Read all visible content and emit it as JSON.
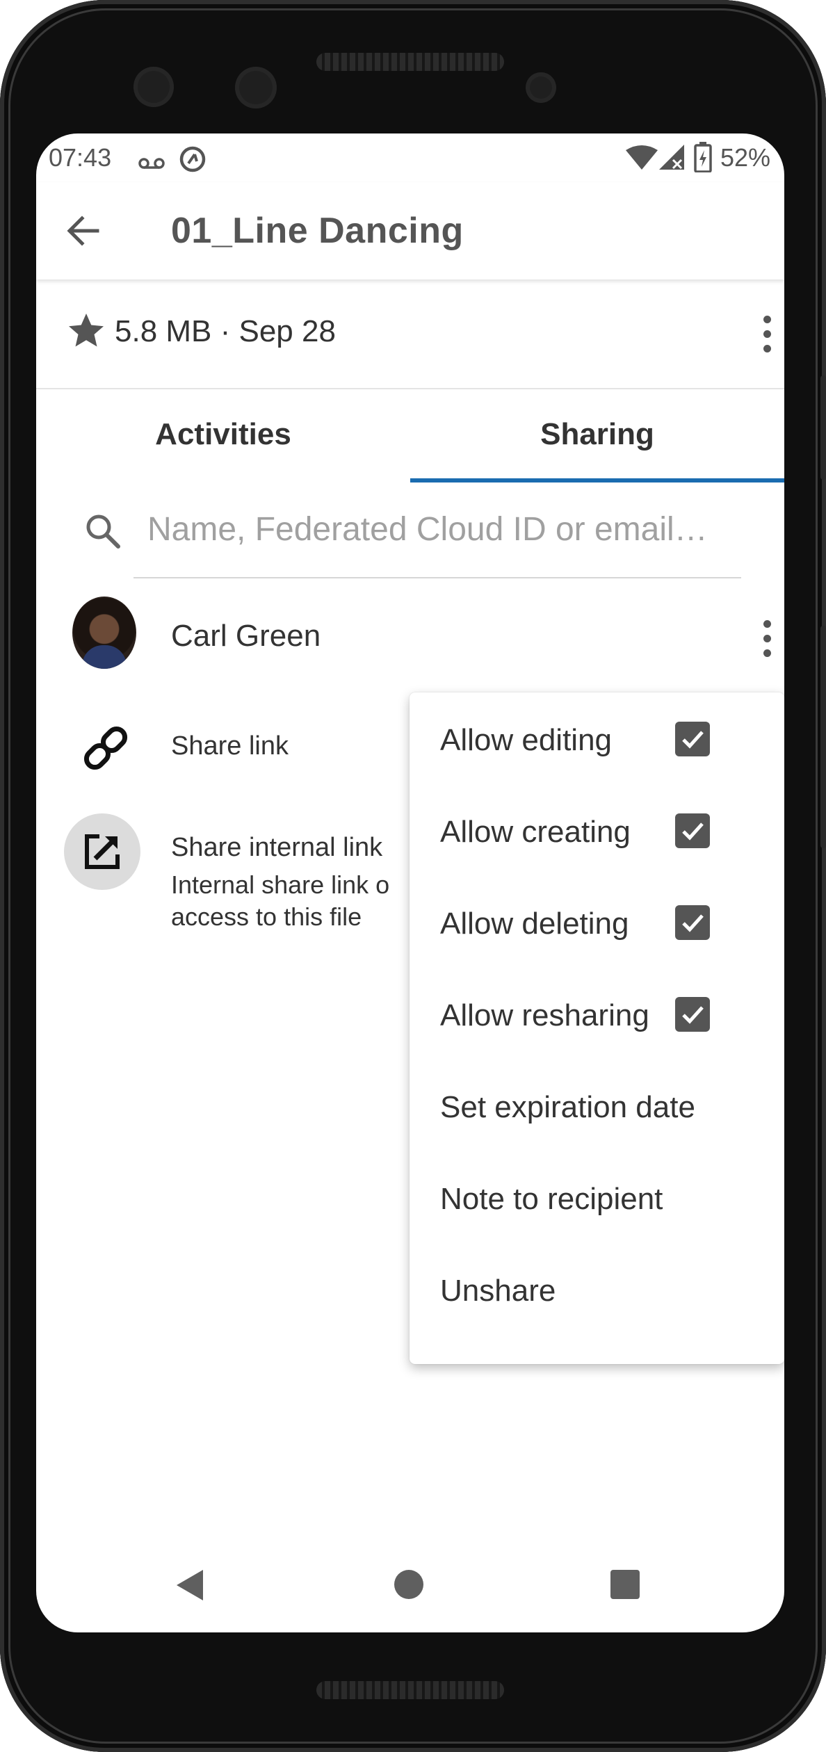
{
  "status_bar": {
    "time": "07:43",
    "battery": "52%",
    "icons": [
      "voicemail-icon",
      "data-saver-icon",
      "wifi-icon",
      "signal-icon",
      "battery-charging-icon"
    ]
  },
  "app_bar": {
    "title": "01_Line Dancing",
    "back_icon": "arrow-left-icon"
  },
  "file_info": {
    "details": "5.8 MB · Sep 28",
    "favorite_icon": "star-icon",
    "menu_icon": "kebab-menu-icon"
  },
  "tabs": [
    {
      "label": "Activities",
      "active": false
    },
    {
      "label": "Sharing",
      "active": true
    }
  ],
  "accent_color": "#1a6cb0",
  "search": {
    "placeholder": "Name, Federated Cloud ID or email…"
  },
  "shares": {
    "user": {
      "name": "Carl Green"
    },
    "share_link": {
      "label": "Share link"
    },
    "internal_link": {
      "label": "Share internal link",
      "description_line1": "Internal share link o",
      "description_line2": "access to this file"
    }
  },
  "menu": {
    "items": [
      {
        "label": "Allow editing",
        "checked": true
      },
      {
        "label": "Allow creating",
        "checked": true
      },
      {
        "label": "Allow deleting",
        "checked": true
      },
      {
        "label": "Allow resharing",
        "checked": true
      },
      {
        "label": "Set expiration date"
      },
      {
        "label": "Note to recipient"
      },
      {
        "label": "Unshare"
      }
    ]
  },
  "nav_bar": {
    "icons": [
      "nav-back-icon",
      "nav-home-icon",
      "nav-recents-icon"
    ]
  }
}
